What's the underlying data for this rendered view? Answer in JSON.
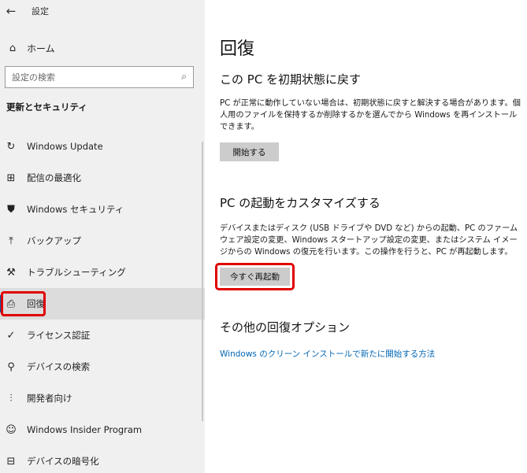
{
  "window": {
    "back_icon": "←",
    "title": "設定"
  },
  "sidebar": {
    "home": {
      "icon": "home-icon",
      "glyph": "⌂",
      "label": "ホーム"
    },
    "search": {
      "placeholder": "設定の検索",
      "glyph": "⌕"
    },
    "section_heading": "更新とセキュリティ",
    "items": [
      {
        "icon": "refresh-icon",
        "glyph": "↻",
        "label": "Windows Update",
        "selected": false
      },
      {
        "icon": "delivery-optimization-icon",
        "glyph": "⊞",
        "label": "配信の最適化",
        "selected": false
      },
      {
        "icon": "shield-icon",
        "glyph": "⛊",
        "label": "Windows セキュリティ",
        "selected": false
      },
      {
        "icon": "backup-icon",
        "glyph": "⤒",
        "label": "バックアップ",
        "selected": false
      },
      {
        "icon": "wrench-icon",
        "glyph": "⚒",
        "label": "トラブルシューティング",
        "selected": false
      },
      {
        "icon": "recovery-icon",
        "glyph": "⎙",
        "label": "回復",
        "selected": true
      },
      {
        "icon": "check-circle-icon",
        "glyph": "✓",
        "label": "ライセンス認証",
        "selected": false
      },
      {
        "icon": "person-pin-icon",
        "glyph": "⚲",
        "label": "デバイスの検索",
        "selected": false
      },
      {
        "icon": "developer-icon",
        "glyph": "⫶",
        "label": "開発者向け",
        "selected": false
      },
      {
        "icon": "insider-icon",
        "glyph": "☺",
        "label": "Windows Insider Program",
        "selected": false
      },
      {
        "icon": "encryption-icon",
        "glyph": "⊟",
        "label": "デバイスの暗号化",
        "selected": false
      }
    ]
  },
  "main": {
    "title": "回復",
    "reset": {
      "heading": "この PC を初期状態に戻す",
      "description": "PC が正常に動作していない場合は、初期状態に戻すと解決する場合があります。個人用のファイルを保持するか削除するかを選んでから Windows を再インストールできます。",
      "button": "開始する"
    },
    "startup": {
      "heading": "PC の起動をカスタマイズする",
      "description": "デバイスまたはディスク (USB ドライブや DVD など) からの起動、PC のファームウェア設定の変更、Windows スタートアップ設定の変更、またはシステム イメージからの Windows の復元を行います。この操作を行うと、PC が再起動します。",
      "button": "今すぐ再起動"
    },
    "more": {
      "heading": "その他の回復オプション",
      "link": "Windows のクリーン インストールで新たに開始する方法"
    }
  },
  "colors": {
    "accent": "#0063b1",
    "link": "#0066b4",
    "highlight": "#e00000"
  }
}
